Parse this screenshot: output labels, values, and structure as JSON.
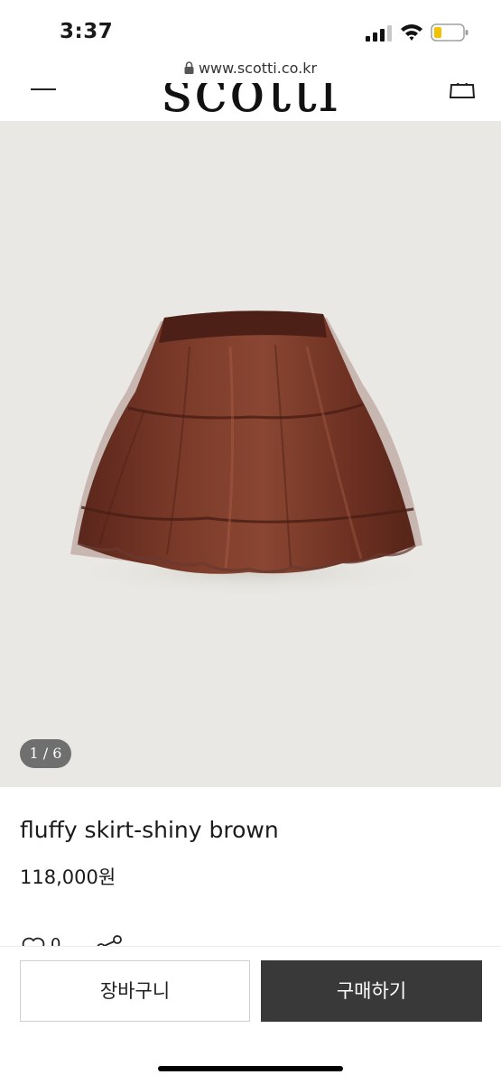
{
  "status_bar": {
    "time": "3:37",
    "icons": [
      "signal-icon",
      "wifi-icon",
      "battery-icon"
    ]
  },
  "browser": {
    "url": "www.scotti.co.kr",
    "icon": "lock-icon"
  },
  "header": {
    "logo": "scotti",
    "icons": [
      "menu-icon",
      "cart-icon"
    ]
  },
  "product": {
    "image_counter": "1 / 6",
    "title": "fluffy skirt-shiny brown",
    "price": "118,000원",
    "like_count": "0",
    "icons": [
      "heart-icon",
      "share-icon"
    ]
  },
  "actions": {
    "cart_label": "장바구니",
    "buy_label": "구매하기"
  },
  "colors": {
    "image_background": "#e9e8e4",
    "skirt_brown": "#6b3124",
    "buy_button": "#393939",
    "counter_badge": "#6f6f6f"
  }
}
